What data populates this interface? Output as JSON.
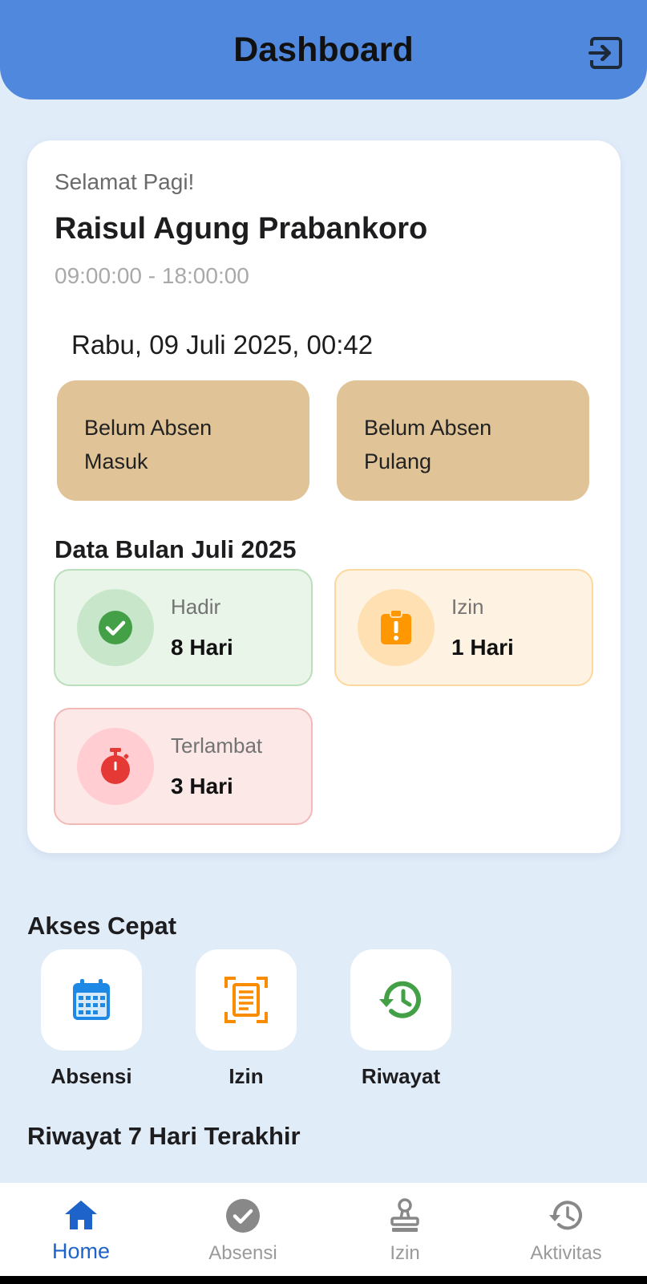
{
  "header": {
    "title": "Dashboard",
    "logout_icon": "logout-icon"
  },
  "card": {
    "greeting": "Selamat Pagi!",
    "name": "Raisul Agung Prabankoro",
    "shift": "09:00:00 - 18:00:00",
    "datetime": "Rabu, 09 Juli 2025, 00:42",
    "check_in": {
      "line1": "Belum Absen",
      "line2": "Masuk"
    },
    "check_out": {
      "line1": "Belum Absen",
      "line2": "Pulang"
    },
    "month_title": "Data Bulan Juli 2025",
    "stats": [
      {
        "label": "Hadir",
        "value": "8 Hari",
        "icon": "check-circle-icon",
        "color": "#43a047"
      },
      {
        "label": "Izin",
        "value": "1 Hari",
        "icon": "clipboard-alert-icon",
        "color": "#ff9800"
      },
      {
        "label": "Terlambat",
        "value": "3 Hari",
        "icon": "stopwatch-icon",
        "color": "#e53935"
      }
    ]
  },
  "quick_access": {
    "title": "Akses Cepat",
    "items": [
      {
        "label": "Absensi",
        "icon": "calendar-icon",
        "color": "#1e88e5"
      },
      {
        "label": "Izin",
        "icon": "document-scan-icon",
        "color": "#fb8c00"
      },
      {
        "label": "Riwayat",
        "icon": "history-icon",
        "color": "#43a047"
      }
    ]
  },
  "history": {
    "title": "Riwayat 7 Hari Terakhir"
  },
  "bottom_nav": {
    "active": "Home",
    "items": [
      {
        "label": "Home",
        "icon": "home-icon"
      },
      {
        "label": "Absensi",
        "icon": "check-circle-icon"
      },
      {
        "label": "Izin",
        "icon": "stamp-icon"
      },
      {
        "label": "Aktivitas",
        "icon": "history-icon"
      }
    ]
  }
}
